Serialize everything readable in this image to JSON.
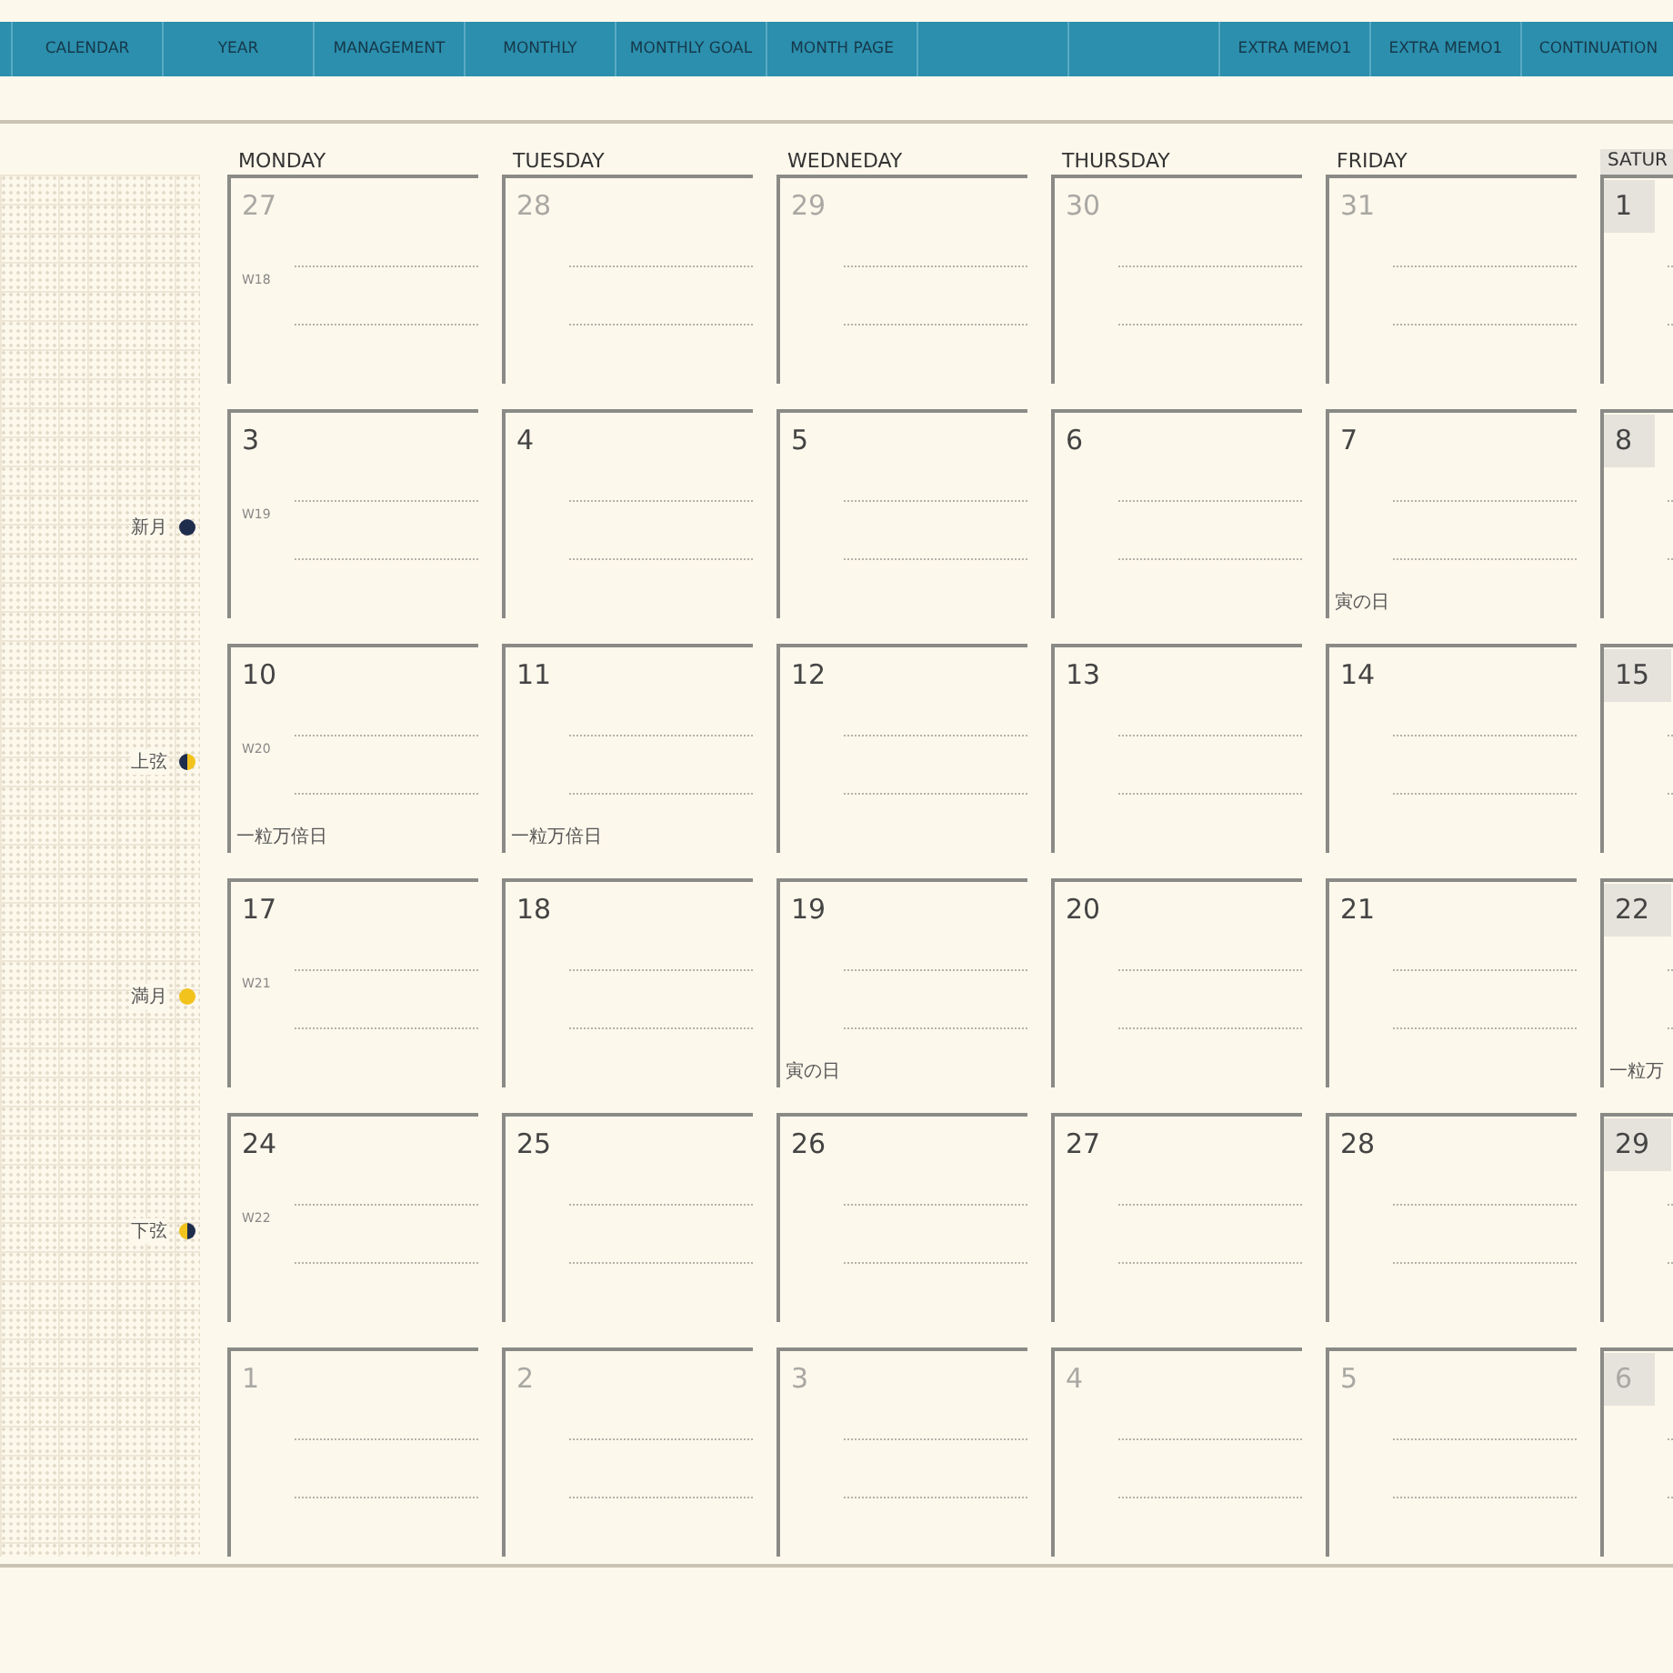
{
  "tabs": [
    {
      "kind": "stub"
    },
    {
      "kind": "label",
      "label": "CALENDAR"
    },
    {
      "kind": "label",
      "label": "YEAR"
    },
    {
      "kind": "label",
      "label": "MANAGEMENT"
    },
    {
      "kind": "label",
      "label": "MONTHLY"
    },
    {
      "kind": "label",
      "label": "MONTHLY GOAL"
    },
    {
      "kind": "label",
      "label": "MONTH PAGE"
    },
    {
      "kind": "blank"
    },
    {
      "kind": "blank"
    },
    {
      "kind": "label",
      "label": "EXTRA MEMO1"
    },
    {
      "kind": "label",
      "label": "EXTRA MEMO1"
    },
    {
      "kind": "label",
      "label": "CONTINUATION"
    }
  ],
  "weekdays": [
    {
      "label": "MONDAY",
      "weekend": false
    },
    {
      "label": "TUESDAY",
      "weekend": false
    },
    {
      "label": "WEDNEDAY",
      "weekend": false
    },
    {
      "label": "THURSDAY",
      "weekend": false
    },
    {
      "label": "FRIDAY",
      "weekend": false
    },
    {
      "label": "SATUR",
      "weekend": true
    }
  ],
  "weeks": [
    {
      "days": [
        {
          "number": "27",
          "muted": true,
          "week": "W18"
        },
        {
          "number": "28",
          "muted": true
        },
        {
          "number": "29",
          "muted": true
        },
        {
          "number": "30",
          "muted": true
        },
        {
          "number": "31",
          "muted": true
        },
        {
          "number": "1",
          "muted": false
        }
      ]
    },
    {
      "moon": {
        "label": "新月",
        "kind": "new"
      },
      "days": [
        {
          "number": "3",
          "muted": false,
          "week": "W19"
        },
        {
          "number": "4",
          "muted": false
        },
        {
          "number": "5",
          "muted": false
        },
        {
          "number": "6",
          "muted": false
        },
        {
          "number": "7",
          "muted": false,
          "note": "寅の日"
        },
        {
          "number": "8",
          "muted": false
        }
      ]
    },
    {
      "moon": {
        "label": "上弦",
        "kind": "first_quarter"
      },
      "days": [
        {
          "number": "10",
          "muted": false,
          "week": "W20",
          "note": "一粒万倍日"
        },
        {
          "number": "11",
          "muted": false,
          "note": "一粒万倍日"
        },
        {
          "number": "12",
          "muted": false
        },
        {
          "number": "13",
          "muted": false
        },
        {
          "number": "14",
          "muted": false
        },
        {
          "number": "15",
          "muted": false
        }
      ]
    },
    {
      "moon": {
        "label": "満月",
        "kind": "full"
      },
      "days": [
        {
          "number": "17",
          "muted": false,
          "week": "W21"
        },
        {
          "number": "18",
          "muted": false
        },
        {
          "number": "19",
          "muted": false,
          "note": "寅の日"
        },
        {
          "number": "20",
          "muted": false
        },
        {
          "number": "21",
          "muted": false
        },
        {
          "number": "22",
          "muted": false,
          "note": "一粒万"
        }
      ]
    },
    {
      "moon": {
        "label": "下弦",
        "kind": "last_quarter"
      },
      "days": [
        {
          "number": "24",
          "muted": false,
          "week": "W22"
        },
        {
          "number": "25",
          "muted": false
        },
        {
          "number": "26",
          "muted": false
        },
        {
          "number": "27",
          "muted": false
        },
        {
          "number": "28",
          "muted": false
        },
        {
          "number": "29",
          "muted": false
        }
      ]
    },
    {
      "days": [
        {
          "number": "1",
          "muted": true
        },
        {
          "number": "2",
          "muted": true
        },
        {
          "number": "3",
          "muted": true
        },
        {
          "number": "4",
          "muted": true
        },
        {
          "number": "5",
          "muted": true
        },
        {
          "number": "6",
          "muted": true
        }
      ]
    }
  ]
}
